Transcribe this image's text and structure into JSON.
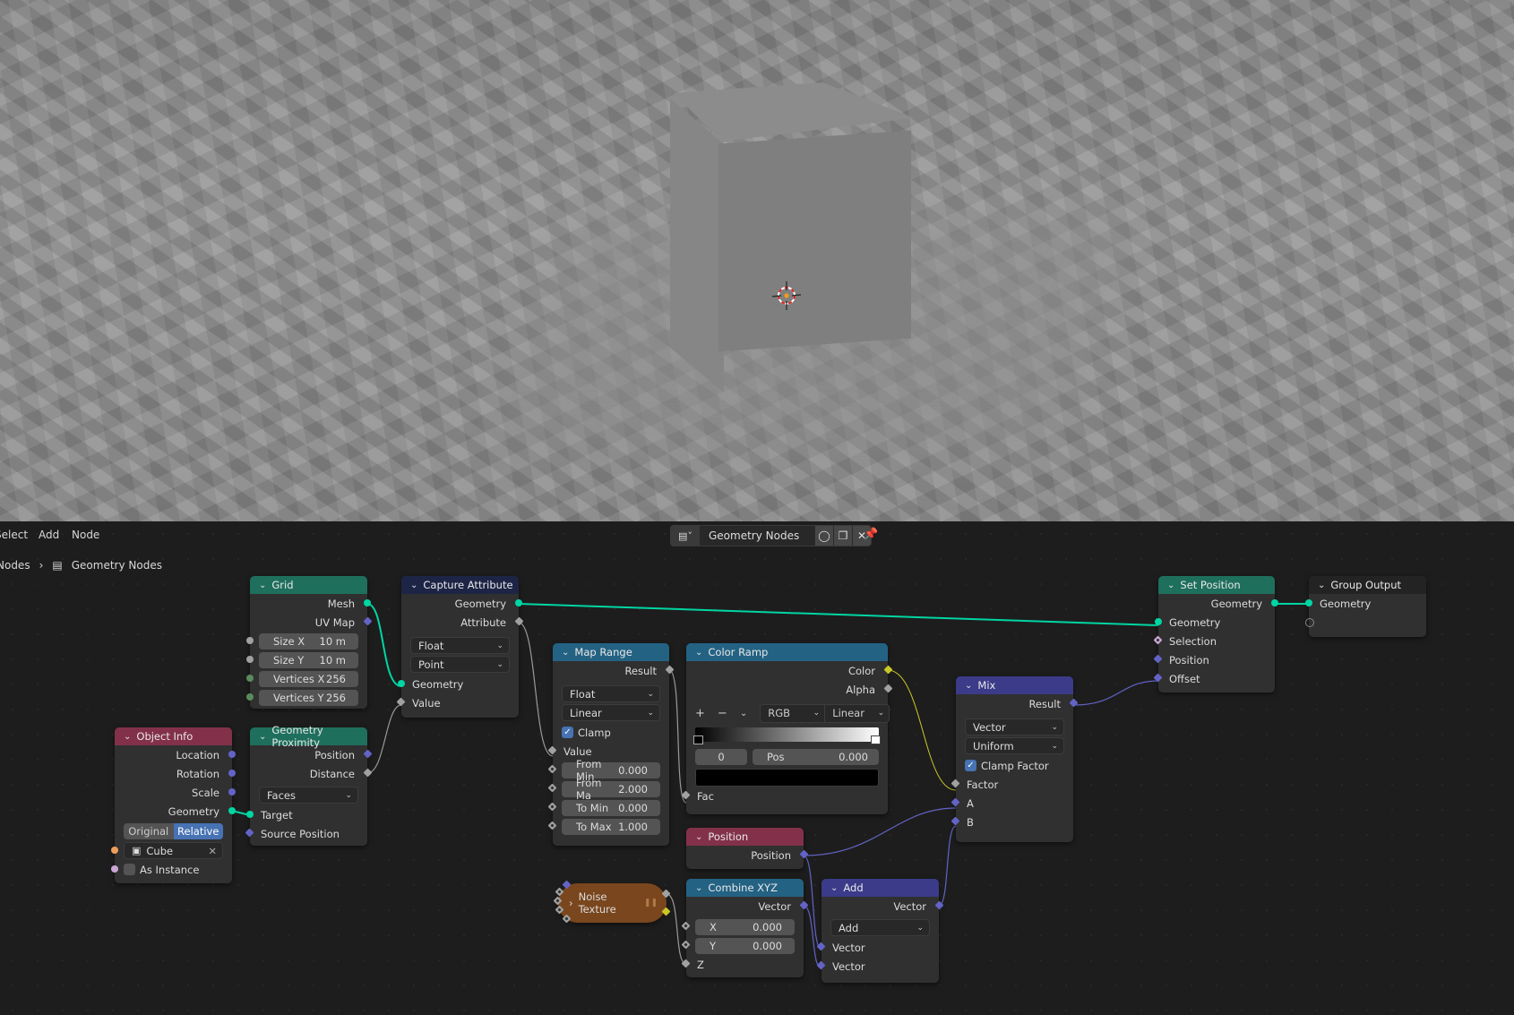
{
  "header": {
    "menu": [
      "Select",
      "Add",
      "Node"
    ],
    "datablock_name": "Geometry Nodes",
    "icons": [
      "node-tree-icon",
      "shield-icon",
      "duplicate-icon",
      "close-icon",
      "pin-icon"
    ]
  },
  "breadcrumb": [
    "Nodes",
    "Geometry Nodes"
  ],
  "nodes": {
    "grid": {
      "title": "Grid",
      "outputs": [
        "Mesh",
        "UV Map"
      ],
      "fields": [
        {
          "label": "Size X",
          "value": "10 m"
        },
        {
          "label": "Size Y",
          "value": "10 m"
        },
        {
          "label": "Vertices X",
          "value": "256"
        },
        {
          "label": "Vertices Y",
          "value": "256"
        }
      ]
    },
    "capture": {
      "title": "Capture Attribute",
      "outputs": [
        "Geometry",
        "Attribute"
      ],
      "selects": [
        "Float",
        "Point"
      ],
      "inputs": [
        "Geometry",
        "Value"
      ]
    },
    "object_info": {
      "title": "Object Info",
      "outputs": [
        "Location",
        "Rotation",
        "Scale",
        "Geometry"
      ],
      "toggle": [
        "Original",
        "Relative"
      ],
      "toggle_active": "Relative",
      "object": "Cube",
      "as_instance": "As Instance"
    },
    "geo_prox": {
      "title": "Geometry Proximity",
      "outputs": [
        "Position",
        "Distance"
      ],
      "select": "Faces",
      "inputs": [
        "Target",
        "Source Position"
      ]
    },
    "map_range": {
      "title": "Map Range",
      "outputs": [
        "Result"
      ],
      "selects": [
        "Float",
        "Linear"
      ],
      "clamp": "Clamp",
      "inputs": [
        "Value"
      ],
      "fields": [
        {
          "label": "From Min",
          "value": "0.000"
        },
        {
          "label": "From Ma",
          "value": "2.000"
        },
        {
          "label": "To Min",
          "value": "0.000"
        },
        {
          "label": "To Max",
          "value": "1.000"
        }
      ]
    },
    "color_ramp": {
      "title": "Color Ramp",
      "outputs": [
        "Color",
        "Alpha"
      ],
      "mode": "RGB",
      "interp": "Linear",
      "index": "0",
      "pos_label": "Pos",
      "pos_value": "0.000",
      "inputs": [
        "Fac"
      ]
    },
    "position": {
      "title": "Position",
      "outputs": [
        "Position"
      ]
    },
    "noise": {
      "title": "Noise Texture"
    },
    "combine": {
      "title": "Combine XYZ",
      "outputs": [
        "Vector"
      ],
      "fields": [
        {
          "label": "X",
          "value": "0.000"
        },
        {
          "label": "Y",
          "value": "0.000"
        }
      ],
      "inputs": [
        "Z"
      ]
    },
    "add": {
      "title": "Add",
      "outputs": [
        "Vector"
      ],
      "select": "Add",
      "inputs": [
        "Vector",
        "Vector"
      ]
    },
    "mix": {
      "title": "Mix",
      "outputs": [
        "Result"
      ],
      "selects": [
        "Vector",
        "Uniform"
      ],
      "clamp": "Clamp Factor",
      "inputs": [
        "Factor",
        "A",
        "B"
      ]
    },
    "set_position": {
      "title": "Set Position",
      "outputs": [
        "Geometry"
      ],
      "inputs": [
        "Geometry",
        "Selection",
        "Position",
        "Offset"
      ]
    },
    "group_output": {
      "title": "Group Output",
      "inputs": [
        "Geometry"
      ]
    }
  },
  "colors": {
    "geometry_header": "#1e6f5c",
    "input_header": "#83314a",
    "converter_header": "#246283",
    "attribute_header": "#1d2546",
    "vector_header": "#3b3b8a",
    "texture_header": "#79461d",
    "output_header": "#232323",
    "geometry_socket": "#00d6a3",
    "vector_socket": "#6363c7",
    "float_socket": "#a1a1a1",
    "color_socket": "#c7c729",
    "selection_active": "#4772b3"
  }
}
